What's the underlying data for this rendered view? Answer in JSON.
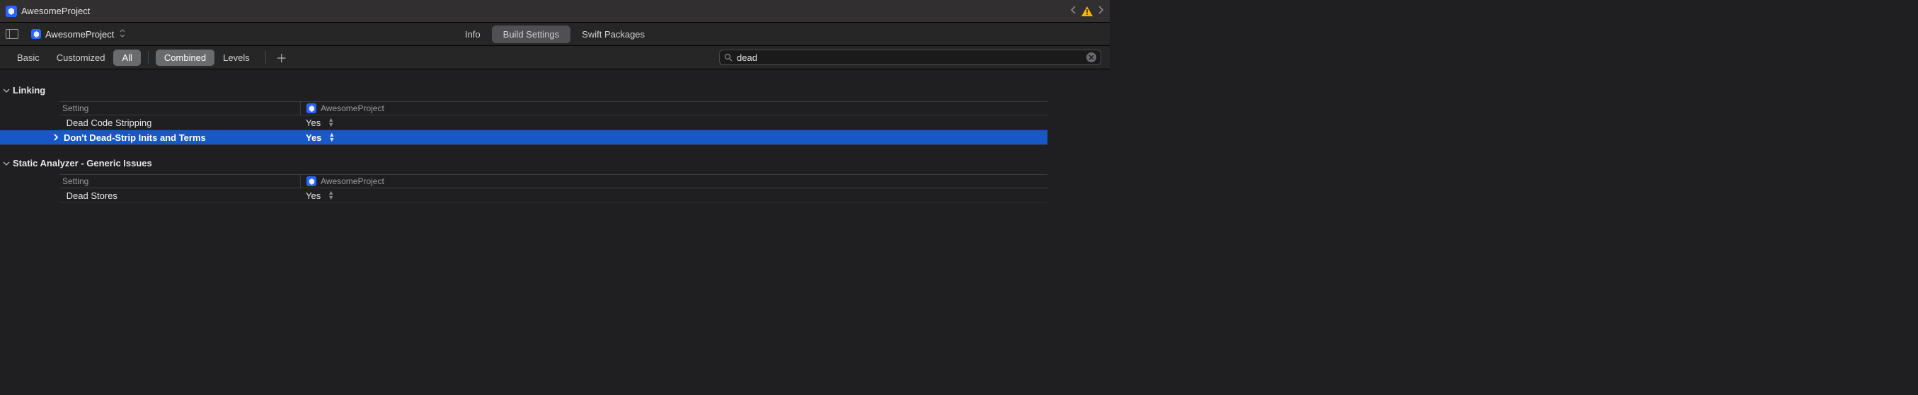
{
  "titlebar": {
    "project_name": "AwesomeProject"
  },
  "pathbar": {
    "project_name": "AwesomeProject",
    "tabs": {
      "info": "Info",
      "build_settings": "Build Settings",
      "swift_packages": "Swift Packages"
    }
  },
  "filterbar": {
    "basic": "Basic",
    "customized": "Customized",
    "all": "All",
    "combined": "Combined",
    "levels": "Levels",
    "search_value": "dead"
  },
  "sections": {
    "linking": {
      "title": "Linking",
      "header_setting": "Setting",
      "header_target": "AwesomeProject",
      "rows": {
        "dead_code_stripping": {
          "label": "Dead Code Stripping",
          "value": "Yes"
        },
        "dont_dead_strip": {
          "label": "Don't Dead-Strip Inits and Terms",
          "value": "Yes"
        }
      }
    },
    "static_analyzer": {
      "title": "Static Analyzer - Generic Issues",
      "header_setting": "Setting",
      "header_target": "AwesomeProject",
      "rows": {
        "dead_stores": {
          "label": "Dead Stores",
          "value": "Yes"
        }
      }
    }
  }
}
